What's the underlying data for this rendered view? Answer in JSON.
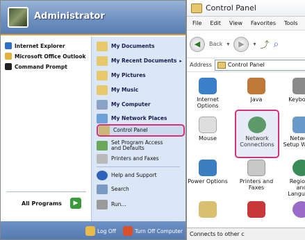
{
  "start_menu": {
    "user_name": "Administrator",
    "pinned": [
      {
        "label": "Internet Explorer",
        "icon": "internet-explorer-icon",
        "color": "#2e6fc9"
      },
      {
        "label": "Microsoft Office Outlook",
        "icon": "outlook-icon",
        "color": "#e2b13c"
      },
      {
        "label": "Command Prompt",
        "icon": "command-prompt-icon",
        "color": "#222222"
      }
    ],
    "right": [
      {
        "label": "My Documents",
        "icon": "documents-icon",
        "color": "#e7c86a",
        "bold": true
      },
      {
        "label": "My Recent Documents",
        "icon": "recent-documents-icon",
        "color": "#e7c86a",
        "bold": true,
        "arrow": "▸"
      },
      {
        "label": "My Pictures",
        "icon": "pictures-icon",
        "color": "#e7c86a",
        "bold": true
      },
      {
        "label": "My Music",
        "icon": "music-icon",
        "color": "#e7c86a",
        "bold": true
      },
      {
        "label": "My Computer",
        "icon": "computer-icon",
        "color": "#8aa2c8",
        "bold": true
      },
      {
        "label": "My Network Places",
        "icon": "network-places-icon",
        "color": "#6fa0d8",
        "bold": true
      },
      {
        "label": "Control Panel",
        "icon": "control-panel-icon",
        "color": "#c9b878",
        "bold": false
      },
      {
        "label": "Set Program Access and Defaults",
        "icon": "program-access-icon",
        "color": "#6aa85c",
        "bold": false
      },
      {
        "label": "Printers and Faxes",
        "icon": "printers-icon",
        "color": "#b9b9b9",
        "bold": false
      },
      {
        "label": "Help and Support",
        "icon": "help-icon",
        "color": "#2f62b9",
        "bold": false
      },
      {
        "label": "Search",
        "icon": "search-icon",
        "color": "#7a9ac4",
        "bold": false
      },
      {
        "label": "Run...",
        "icon": "run-icon",
        "color": "#9a9a9a",
        "bold": false
      }
    ],
    "all_programs": "All Programs",
    "all_programs_arrow": "▶",
    "log_off": "Log Off",
    "turn_off": "Turn Off Computer",
    "accent_color": "#d4307c"
  },
  "control_panel": {
    "title": "Control Panel",
    "menu": [
      "File",
      "Edit",
      "View",
      "Favorites",
      "Tools"
    ],
    "back_label": "Back",
    "address_label": "Address",
    "address_value": "Control Panel",
    "items": [
      {
        "label": "Internet Options",
        "icon": "internet-options-icon",
        "color": "#3a7fc9"
      },
      {
        "label": "Java",
        "icon": "java-icon",
        "color": "#c07838"
      },
      {
        "label": "Keyboard",
        "icon": "keyboard-icon",
        "color": "#8a8a8a"
      },
      {
        "label": "Mouse",
        "icon": "mouse-icon",
        "color": "#dedede"
      },
      {
        "label": "Network Connections",
        "icon": "network-connections-icon",
        "color": "#5c9a6a"
      },
      {
        "label": "Network Setup Wizard",
        "icon": "network-setup-icon",
        "color": "#6a9ac8"
      },
      {
        "label": "Power Options",
        "icon": "power-options-icon",
        "color": "#3c7fc0"
      },
      {
        "label": "Printers and Faxes",
        "icon": "printers-faxes-icon",
        "color": "#c8c8c8"
      },
      {
        "label": "Regional and Language",
        "icon": "regional-icon",
        "color": "#3a8a58"
      },
      {
        "label": "",
        "icon": "scanners-icon",
        "color": "#d8c070"
      },
      {
        "label": "",
        "icon": "security-center-icon",
        "color": "#c83838"
      },
      {
        "label": "",
        "icon": "sounds-icon",
        "color": "#9a6ac8"
      }
    ],
    "status_text": "Connects to other c"
  }
}
